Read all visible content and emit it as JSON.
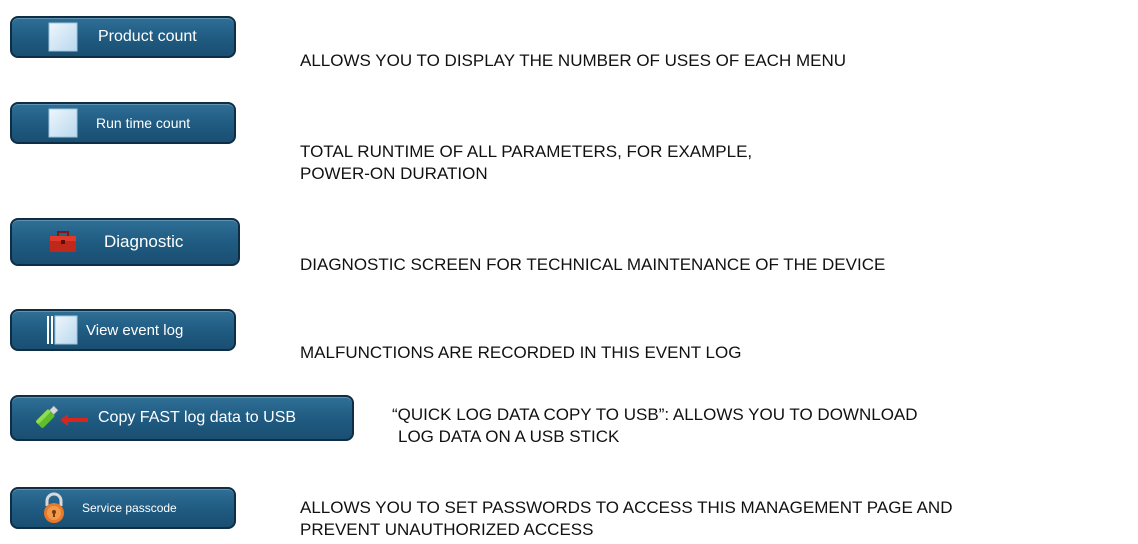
{
  "items": [
    {
      "label": "Product count",
      "icon": "blank-tile-icon",
      "description": [
        "ALLOWS YOU TO DISPLAY THE NUMBER OF USES OF EACH MENU"
      ]
    },
    {
      "label": "Run time count",
      "icon": "blank-tile-icon",
      "description": [
        "TOTAL RUNTIME OF ALL PARAMETERS, FOR EXAMPLE,",
        "POWER-ON DURATION"
      ]
    },
    {
      "label": "Diagnostic",
      "icon": "toolbox-icon",
      "description": [
        "DIAGNOSTIC SCREEN FOR TECHNICAL MAINTENANCE OF THE DEVICE"
      ]
    },
    {
      "label": "View event log",
      "icon": "event-log-icon",
      "description": [
        "MALFUNCTIONS ARE RECORDED IN THIS EVENT LOG"
      ]
    },
    {
      "label": "Copy FAST log data to USB",
      "icon": "usb-copy-icon",
      "description": [
        "“QUICK LOG DATA COPY TO USB”: ALLOWS YOU TO DOWNLOAD",
        "LOG DATA ON A USB STICK"
      ]
    },
    {
      "label": "Service passcode",
      "icon": "padlock-icon",
      "description": [
        "ALLOWS YOU TO SET PASSWORDS TO ACCESS THIS MANAGEMENT PAGE AND",
        "PREVENT UNAUTHORIZED ACCESS"
      ]
    }
  ],
  "colors": {
    "button_top": "#2f6f96",
    "button_bottom": "#1a4f72",
    "button_border": "#0d2e45",
    "button_text": "#ffffff",
    "description_text": "#111111"
  }
}
